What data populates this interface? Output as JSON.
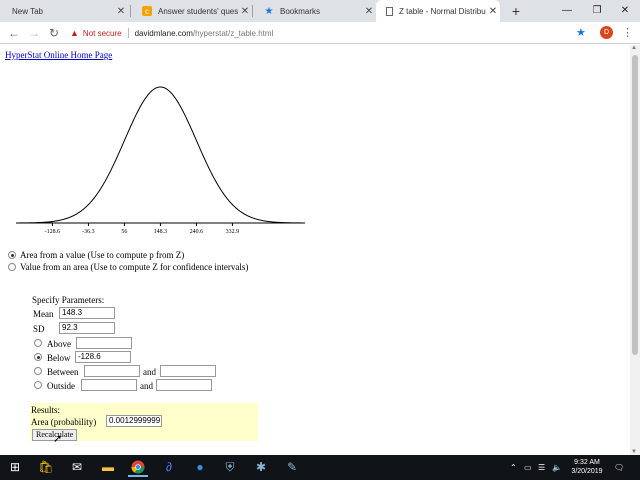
{
  "browser": {
    "tabs": [
      {
        "title": "New Tab",
        "icon": "none",
        "active": false
      },
      {
        "title": "Answer students' questio",
        "icon": "chegg-icon",
        "active": false
      },
      {
        "title": "Bookmarks",
        "icon": "star-icon",
        "active": false
      },
      {
        "title": "Z table - Normal Distribu",
        "icon": "page-icon",
        "active": true
      }
    ],
    "security_label": "Not secure",
    "url_host": "davidmlane.com",
    "url_path": "/hyperstat/z_table.html",
    "profile_initial": "D",
    "accent_color": "#1a73e8",
    "warning_color": "#c5221f"
  },
  "page": {
    "home_link": "HyperStat Online Home Page",
    "chart_data": {
      "type": "line",
      "mean": 148.3,
      "sd": 92.3,
      "x_ticks": [
        "-128.6",
        "-36.3",
        "56",
        "148.3",
        "240.6",
        "332.9"
      ],
      "x_tick_values": [
        -128.6,
        -36.3,
        56,
        148.3,
        240.6,
        332.9
      ],
      "xlim": [
        -222,
        519
      ],
      "shaded_below": -128.6
    },
    "mode_options": [
      {
        "label": "Area from a value (Use to compute p from Z)",
        "checked": true
      },
      {
        "label": "Value from an area (Use to compute Z for confidence intervals)",
        "checked": false
      }
    ],
    "params": {
      "heading": "Specify Parameters:",
      "mean_label": "Mean",
      "mean_value": "148.3",
      "sd_label": "SD",
      "sd_value": "92.3",
      "above_label": "Above",
      "above_value": "",
      "below_label": "Below",
      "below_value": "-128.6",
      "between_label": "Between",
      "between_from": "",
      "and_label": "and",
      "between_to": "",
      "outside_label": "Outside",
      "outside_from": "",
      "outside_to": ""
    },
    "results": {
      "heading": "Results:",
      "area_label": "Area (probability)",
      "area_value": "0.0012999999",
      "recalculate_label": "Recalculate"
    }
  },
  "taskbar": {
    "time": "9:32 AM",
    "date": "3/20/2019"
  }
}
